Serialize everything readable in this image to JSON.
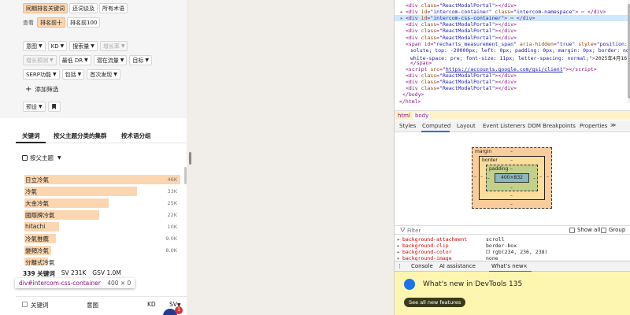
{
  "filters": {
    "row1": [
      "同期排名关键词",
      "还词谈及",
      "所有术语"
    ],
    "row2_label": "查看",
    "row2": [
      "排名前十",
      "排名前100"
    ],
    "row3": [
      "意图",
      "KD",
      "搜索量",
      "增长率"
    ],
    "row4": [
      "增长预测",
      "最低 DR",
      "潜在流量",
      "目标"
    ],
    "row5": [
      "SERP功能",
      "包括",
      "首次发现"
    ],
    "add_filter": "添加筛选",
    "preset": "预设"
  },
  "tabs": [
    "关键词",
    "按父主题分类的集群",
    "按术语分组"
  ],
  "parent_topic_label": "按父主题",
  "keywords": [
    {
      "label": "日立冷氣",
      "value": "46K",
      "frac": 1.0
    },
    {
      "label": "冷氣",
      "value": "33K",
      "frac": 0.72
    },
    {
      "label": "大金冷氣",
      "value": "25K",
      "frac": 0.54
    },
    {
      "label": "國際牌冷氣",
      "value": "22K",
      "frac": 0.48
    },
    {
      "label": "hitachi",
      "value": "10K",
      "frac": 0.22
    },
    {
      "label": "冷氣推薦",
      "value": "9.0K",
      "frac": 0.2
    },
    {
      "label": "變頻冷氣",
      "value": "8.0K",
      "frac": 0.17
    },
    {
      "label": "分離式冷氣",
      "value": "",
      "frac": 0.15
    }
  ],
  "stats": {
    "count": "339 关键词",
    "sv": "SV 231K",
    "gsv": "GSV 1.0M"
  },
  "tooltip": {
    "selector": "div#intercom-css-container",
    "size": "400 × 0"
  },
  "table_header": {
    "keyword": "关键词",
    "intent": "意图",
    "kd": "KD",
    "sv": "SV"
  },
  "notif_count": "1",
  "dom": {
    "lines": [
      {
        "indent": 14,
        "tw": false,
        "html": "&lt;div <span class='attr'>class</span>=<span class='val'>\"ReactModalPortal\"</span>&gt;&lt;/div&gt;"
      },
      {
        "indent": 14,
        "tw": true,
        "html": "&lt;div <span class='attr'>id</span>=<span class='val'>\"intercom-container\"</span> <span class='attr'>class</span>=<span class='val'>\"intercom-namespace\"</span>&gt; <span class='txt'>⋯</span> &lt;/div&gt;"
      },
      {
        "indent": 14,
        "tw": true,
        "html": "&lt;div <span class='attr'>id</span>=<span class='val'>\"intercom-css-container\"</span>&gt; <span class='txt'>⋯</span> &lt;/div&gt;"
      },
      {
        "indent": 14,
        "tw": false,
        "html": "&lt;div <span class='attr'>class</span>=<span class='val'>\"ReactModalPortal\"</span>&gt;&lt;/div&gt;"
      },
      {
        "indent": 14,
        "tw": false,
        "html": "&lt;div <span class='attr'>class</span>=<span class='val'>\"ReactModalPortal\"</span>&gt;&lt;/div&gt;"
      },
      {
        "indent": 14,
        "tw": false,
        "html": "&lt;div <span class='attr'>class</span>=<span class='val'>\"ReactModalPortal\"</span>&gt;&lt;/div&gt;"
      },
      {
        "indent": 14,
        "tw": false,
        "html": "&lt;span <span class='attr'>id</span>=<span class='val'>\"recharts_measurement_span\"</span> <span class='attr'>aria-hidden</span>=<span class='val'>\"true\"</span> <span class='attr'>style</span>=<span class='val'>\"position: ab</span>"
      },
      {
        "indent": 20,
        "tw": false,
        "html": "<span class='val'>solute; top: -20000px; left: 0px; padding: 0px; margin: 0px; border: none;</span>"
      },
      {
        "indent": 20,
        "tw": false,
        "html": "<span class='val'>white-space: pre; font-size: 11px; letter-spacing: normal;\"</span>&gt;<span class='txt'>2025年4月16日</span>"
      },
      {
        "indent": 20,
        "tw": false,
        "html": "&lt;/span&gt;"
      },
      {
        "indent": 14,
        "tw": false,
        "html": "&lt;script <span class='attr'>src</span>=<span class='val'>\"<u>https://accounts.google.com/gsi/client</u>\"</span>&gt;&lt;/script&gt;"
      },
      {
        "indent": 14,
        "tw": false,
        "html": "&lt;div <span class='attr'>class</span>=<span class='val'>\"ReactModalPortal\"</span>&gt;&lt;/div&gt;"
      },
      {
        "indent": 14,
        "tw": false,
        "html": "&lt;div <span class='attr'>class</span>=<span class='val'>\"ReactModalPortal\"</span>&gt;&lt;/div&gt;"
      },
      {
        "indent": 14,
        "tw": false,
        "html": "&lt;div <span class='attr'>class</span>=<span class='val'>\"ReactModalPortal\"</span>&gt;&lt;/div&gt;"
      },
      {
        "indent": 10,
        "tw": false,
        "html": "&lt;/body&gt;"
      },
      {
        "indent": 6,
        "tw": false,
        "html": "&lt;/html&gt;"
      }
    ],
    "breadcrumb": [
      "html",
      "body"
    ]
  },
  "panel_tabs": [
    "Styles",
    "Computed",
    "Layout",
    "Event Listeners",
    "DOM Breakpoints",
    "Properties"
  ],
  "panel_more": "≫",
  "box": {
    "margin": "margin",
    "border": "border",
    "padding": "padding",
    "dash": "–",
    "content": "400×832"
  },
  "filter_placeholder": "Filter",
  "show_all": "Show all",
  "group": "Group",
  "props": [
    {
      "name": "background-attachment",
      "value": "scroll"
    },
    {
      "name": "background-clip",
      "value": "border-box"
    },
    {
      "name": "background-color",
      "value": "rgb(234, 236, 238)"
    },
    {
      "name": "background-image",
      "value": "none"
    }
  ],
  "drawer_tabs": [
    "Console",
    "AI assistance",
    "What's new"
  ],
  "whatsnew": {
    "title": "What's new in DevTools 135",
    "button": "See all new features"
  },
  "colors": {
    "accent": "#fbd6b0",
    "selection": "#cfe8fc",
    "margin": "#f9cc9d",
    "border": "#fddd9b",
    "padding": "#c3d08b",
    "content": "#8cb6c0",
    "whatsnew_bg": "#fdf6b1"
  }
}
